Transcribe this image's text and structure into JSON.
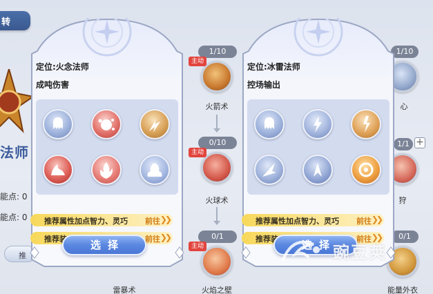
{
  "background": {
    "top_tab": "转",
    "left_class": "法师",
    "left_stats": [
      "能点: 0",
      "能点: 0"
    ],
    "left_button": "推",
    "skills": [
      {
        "level": "1/10",
        "active_tag": "主动",
        "name": "火箭术"
      },
      {
        "level": "0/10",
        "active_tag": "主动",
        "name": "火球术"
      },
      {
        "level": "0/1",
        "active_tag": "主动",
        "name": "火焰之壁"
      },
      {
        "level": "1/10",
        "name": "心"
      },
      {
        "level": "1/1",
        "name": "狩"
      },
      {
        "level": "0/1",
        "name": "能量外衣"
      },
      {
        "name": "雷暴术"
      }
    ]
  },
  "panels": [
    {
      "role": "定位:火念法师",
      "style": "成吨伤害",
      "skill_icons": [
        "fire-ghost-icon",
        "fire-orb-icon",
        "fire-burst-icon",
        "flame-wave-icon",
        "fire-pillar-icon",
        "flame-spirit-icon"
      ],
      "attr_label": "推荐属性加点智力、灵巧",
      "attr_go": "前往",
      "gear_label": "推荐装备",
      "gear_go": "前往",
      "select_label": "选择"
    },
    {
      "role": "定位:冰雷法师",
      "style": "控场输出",
      "skill_icons": [
        "ice-ghost-icon",
        "lightning-icon",
        "thunder-burst-icon",
        "ice-spike-icon",
        "frost-shard-icon",
        "fire-ring-icon"
      ],
      "attr_label": "推荐属性加点智力、灵巧",
      "attr_go": "前往",
      "gear_label": "推荐装备",
      "gear_go": "前往",
      "select_label": "选择"
    }
  ],
  "watermark": "豌豆荚"
}
